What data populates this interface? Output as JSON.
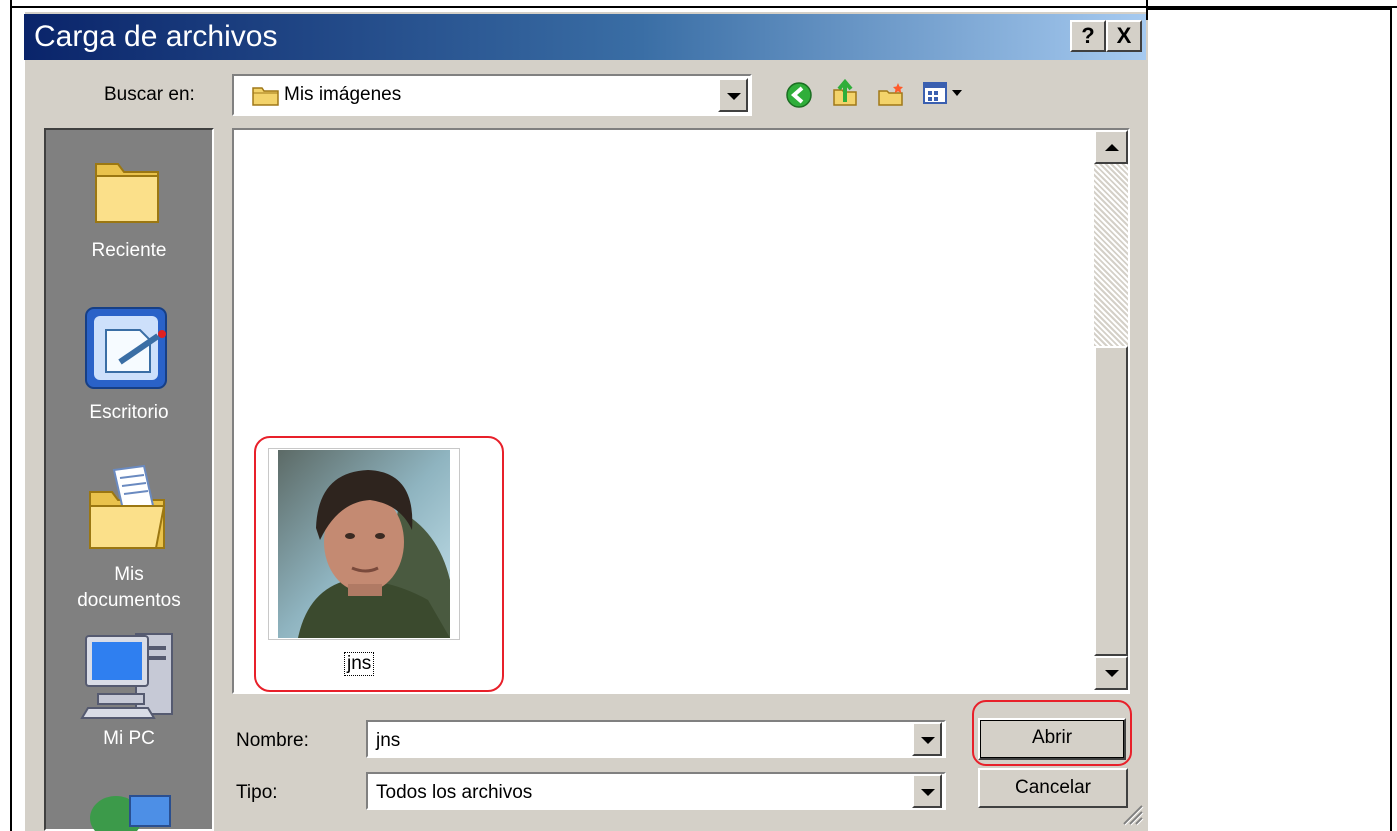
{
  "window": {
    "title": "Carga de archivos",
    "help_label": "?",
    "close_label": "X"
  },
  "toolbar": {
    "look_in_label": "Buscar en:",
    "look_in_value": "Mis imágenes",
    "icons": [
      "back-icon",
      "up-folder-icon",
      "new-folder-icon",
      "views-menu-icon"
    ]
  },
  "places": {
    "items": [
      {
        "label": "Reciente",
        "icon": "folder-icon"
      },
      {
        "label": "Escritorio",
        "icon": "desktop-icon"
      },
      {
        "label": "Mis\ndocumentos",
        "icon": "my-documents-icon"
      },
      {
        "label": "Mi PC",
        "icon": "my-computer-icon"
      }
    ]
  },
  "files": {
    "items": [
      {
        "name": "jns",
        "icon": "photo-thumbnail"
      }
    ]
  },
  "form": {
    "name_label": "Nombre:",
    "name_value": "jns",
    "type_label": "Tipo:",
    "type_value": "Todos los archivos"
  },
  "buttons": {
    "open_label": "Abrir",
    "cancel_label": "Cancelar"
  },
  "colors": {
    "title_gradient_start": "#0a246a",
    "title_gradient_end": "#a6caf0",
    "dialog_face": "#d4d0c8",
    "highlight_red": "#e8202a"
  }
}
